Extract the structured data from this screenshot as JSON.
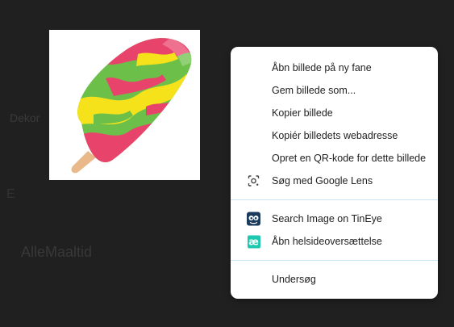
{
  "background": {
    "text_1": "Dekor",
    "text_2": "AlleMaaltid",
    "text_3": "E",
    "color": "#202020"
  },
  "image": {
    "name": "popsicle image",
    "colors": [
      "#e8436b",
      "#f5e21b",
      "#6cc04a",
      "#e9b98a"
    ]
  },
  "context_menu": {
    "items": [
      {
        "label": "Åbn billede på ny fane",
        "icon": null
      },
      {
        "label": "Gem billede som...",
        "icon": null
      },
      {
        "label": "Kopier billede",
        "icon": null
      },
      {
        "label": "Kopiér billedets webadresse",
        "icon": null
      },
      {
        "label": "Opret en QR-kode for dette billede",
        "icon": null
      },
      {
        "label": "Søg med Google Lens",
        "icon": "google-lens-icon"
      },
      {
        "label": "Search Image on TinEye",
        "icon": "tineye-icon"
      },
      {
        "label": "Åbn helsideoversættelse",
        "icon": "translate-extension-icon"
      },
      {
        "label": "Undersøg",
        "icon": null
      }
    ],
    "separator_color": "#c9e4f2"
  }
}
